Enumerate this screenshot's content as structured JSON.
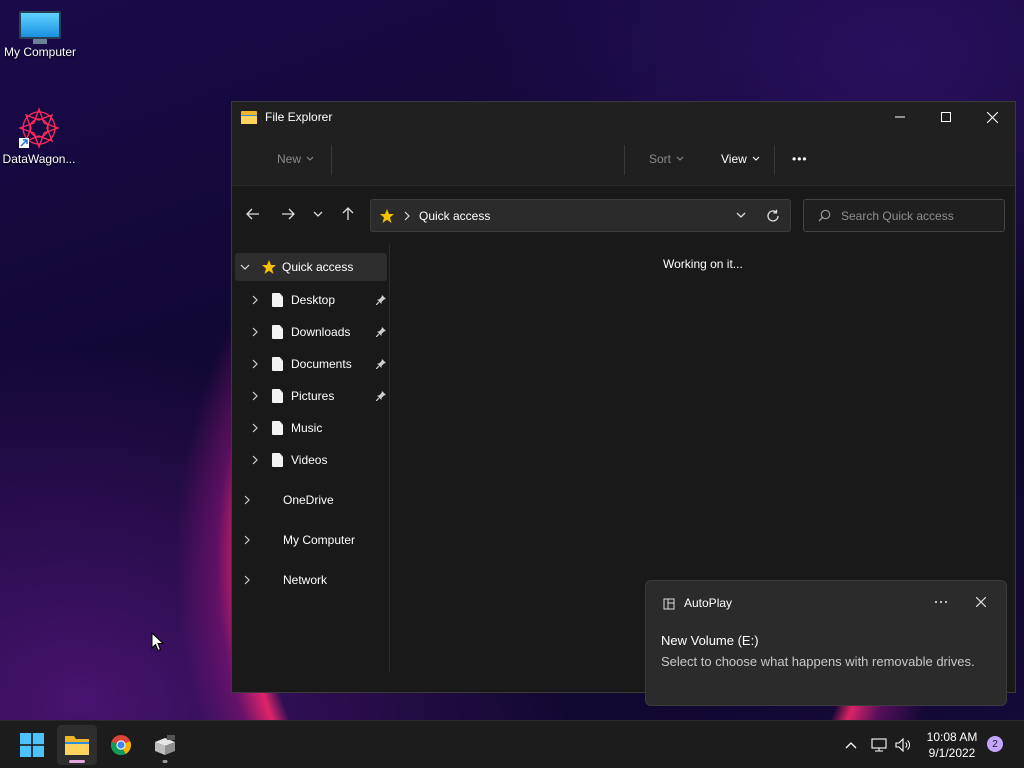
{
  "desktop": {
    "icons": [
      {
        "label": "My Computer",
        "icon": "computer-monitor-icon"
      },
      {
        "label": "DataWagon...",
        "icon": "mandala-shortcut-icon"
      }
    ]
  },
  "window": {
    "title": "File Explorer",
    "toolbar": {
      "new_label": "New",
      "sort_label": "Sort",
      "view_label": "View",
      "more_label": "•••"
    },
    "address": {
      "location": "Quick access",
      "search_placeholder": "Search Quick access"
    },
    "nav": {
      "quick_access": "Quick access",
      "pinned": [
        {
          "label": "Desktop",
          "pinned": true
        },
        {
          "label": "Downloads",
          "pinned": true
        },
        {
          "label": "Documents",
          "pinned": true
        },
        {
          "label": "Pictures",
          "pinned": true
        },
        {
          "label": "Music",
          "pinned": false
        },
        {
          "label": "Videos",
          "pinned": false
        }
      ],
      "roots": [
        "OneDrive",
        "My Computer",
        "Network"
      ]
    },
    "content": {
      "status": "Working on it..."
    }
  },
  "toast": {
    "app": "AutoPlay",
    "heading": "New Volume (E:)",
    "body": "Select to choose what happens with removable drives."
  },
  "taskbar": {
    "time": "10:08 AM",
    "date": "9/1/2022",
    "notifications": "2"
  },
  "colors": {
    "accent": "#4cc2ff",
    "window_bg": "#191919",
    "toolbar_bg": "#202020",
    "star": "#f5c000"
  }
}
